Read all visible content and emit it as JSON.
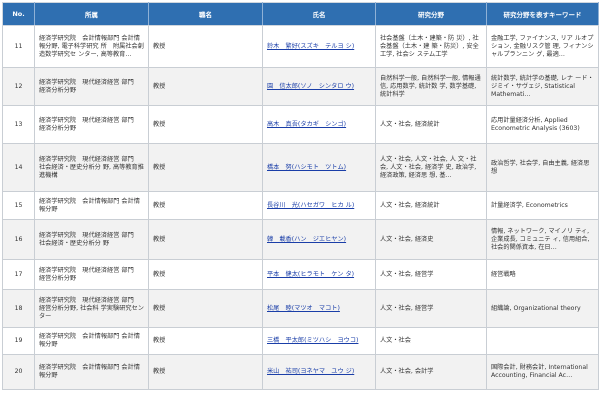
{
  "headers": {
    "no": "No.",
    "affiliation": "所属",
    "position": "職名",
    "name": "氏名",
    "field": "研究分野",
    "keywords": "研究分野を表すキーワード"
  },
  "rows": [
    {
      "no": "11",
      "affiliation": "経済学研究院　会計情報部門 会計情報分野, 電子科学研究 所　附属社会創造数学研究セ ンター, 高等教育…",
      "position": "教授",
      "name": "鈴木　繁好(スズキ　テルヨ シ)",
      "field": "社会基盤（土木・建築・防 災）, 社会基盤（土木・建 築・防災）, 安全工学, 社会シ ステム工学",
      "keywords": "金融工学, ファイナンス, リア ルオプション, 金融リスク管 理, フィナンシャルプランニン グ, 最適…"
    },
    {
      "no": "12",
      "affiliation": "経済学研究院　現代経済経営 部門　経済分析分野",
      "position": "教授",
      "name": "園　信太郎(ソノ　シンタロ ウ)",
      "field": "自然科学一般, 自然科学一般, 情報通信, 応用数学, 統計数 学, 数学基礎, 統計科学",
      "keywords": "統計数学, 統計学の基礎, レナ ード・ジミイ・サヴェジ, Statistical Mathemati…"
    },
    {
      "no": "13",
      "affiliation": "経済学研究院　現代経済経営 部門　経済分析分野",
      "position": "教授",
      "name": "高木　真吾(タカギ　シンゴ)",
      "field": "人文・社会, 経済統計",
      "keywords": "応用計量経済分析, Applied Econometric Analysis (3603)"
    },
    {
      "no": "14",
      "affiliation": "経済学研究院　現代経済経営 部門　社会経済・歴史分析分 野, 高等教育推進機構",
      "position": "教授",
      "name": "橋本　努(ハシモト　ツトム)",
      "field": "人文・社会, 人文・社会, 人 文・社会, 人文・社会, 経済学 史, 政治学, 経済政策, 経済思 想, 基…",
      "keywords": "政治哲学, 社会学, 自由主義, 経済思想"
    },
    {
      "no": "15",
      "affiliation": "経済学研究院　会計情報部門 会計情報分野",
      "position": "教授",
      "name": "長谷川　光(ハセガワ　ヒカ ル)",
      "field": "人文・社会, 経済統計",
      "keywords": "計量経済学, Econometrics"
    },
    {
      "no": "16",
      "affiliation": "経済学研究院　現代経済経営 部門　社会経済・歴史分析分 野",
      "position": "教授",
      "name": "韓　載香(ハン　ジエヒヤン)",
      "field": "人文・社会, 経済史",
      "keywords": "情報, ネットワーク, マイノリ ティ, 企業成長, コミュニテ ィ, 信用組合, 社会的関係資本, 在日…"
    },
    {
      "no": "17",
      "affiliation": "経済学研究院　現代経済経営 部門　経営分析分野",
      "position": "教授",
      "name": "平本　健太(ヒラモト　ケン タ)",
      "field": "人文・社会, 経営学",
      "keywords": "経営戦略"
    },
    {
      "no": "18",
      "affiliation": "経済学研究院　現代経済経営 部門　経営分析分野, 社会科 学実験研究センター",
      "position": "教授",
      "name": "松尾　睦(マツオ　マコト)",
      "field": "人文・社会, 経営学",
      "keywords": "組織論, Organizational theory"
    },
    {
      "no": "19",
      "affiliation": "経済学研究院　会計情報部門 会計情報分野",
      "position": "教授",
      "name": "三橋　平太郎(ミツハシ　ヨウコ)",
      "field": "人文・社会",
      "keywords": ""
    },
    {
      "no": "20",
      "affiliation": "経済学研究院　会計情報部門 会計情報分野",
      "position": "教授",
      "name": "米山　祐司(ヨネヤマ　ユウ ジ)",
      "field": "人文・社会, 会計学",
      "keywords": "国際会計, 財務会計, International Accounting, Financial Ac…"
    }
  ]
}
